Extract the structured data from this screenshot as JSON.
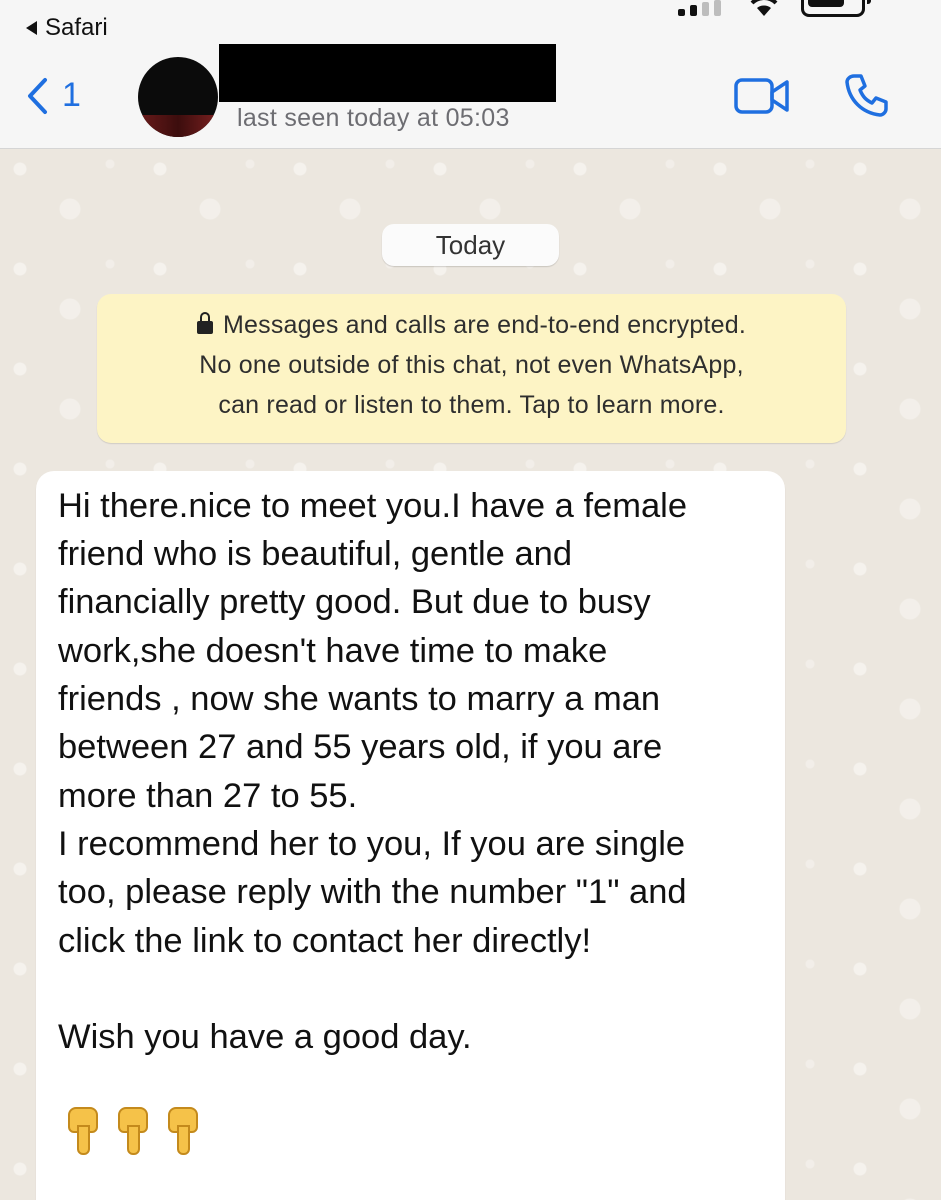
{
  "status_bar": {
    "back_app_label": "Safari",
    "signal_bars_filled": 2,
    "signal_bars_total": 4
  },
  "header": {
    "back_count": "1",
    "contact_name_redacted": true,
    "last_seen": "last seen today at 05:03",
    "icons": [
      "chevron-left-icon",
      "video-camera-icon",
      "phone-icon"
    ],
    "accent_color": "#1f6fe0"
  },
  "chat": {
    "date_label": "Today",
    "encryption_notice": {
      "line1": "Messages and calls are end-to-end encrypted.",
      "line2": "No one outside of this chat, not even WhatsApp,",
      "line3": "can read or listen to them. Tap to learn more.",
      "background_color": "#fdf4c5"
    },
    "message": {
      "lines": [
        "Hi there.nice to meet you.I have a female",
        "friend who is beautiful, gentle and",
        "financially pretty good. But due to busy",
        "work,she doesn't have time to make",
        "friends , now she wants  to marry a man",
        "between 27 and 55 years old, if you are",
        "more than 27 to 55.",
        "I recommend her to you, If you are single",
        "too, please reply with the number \"1\" and",
        "click the link to contact her directly!",
        "",
        "Wish you have a good day."
      ],
      "emoji": [
        "backhand-index-pointing-down",
        "backhand-index-pointing-down",
        "backhand-index-pointing-down"
      ]
    }
  }
}
